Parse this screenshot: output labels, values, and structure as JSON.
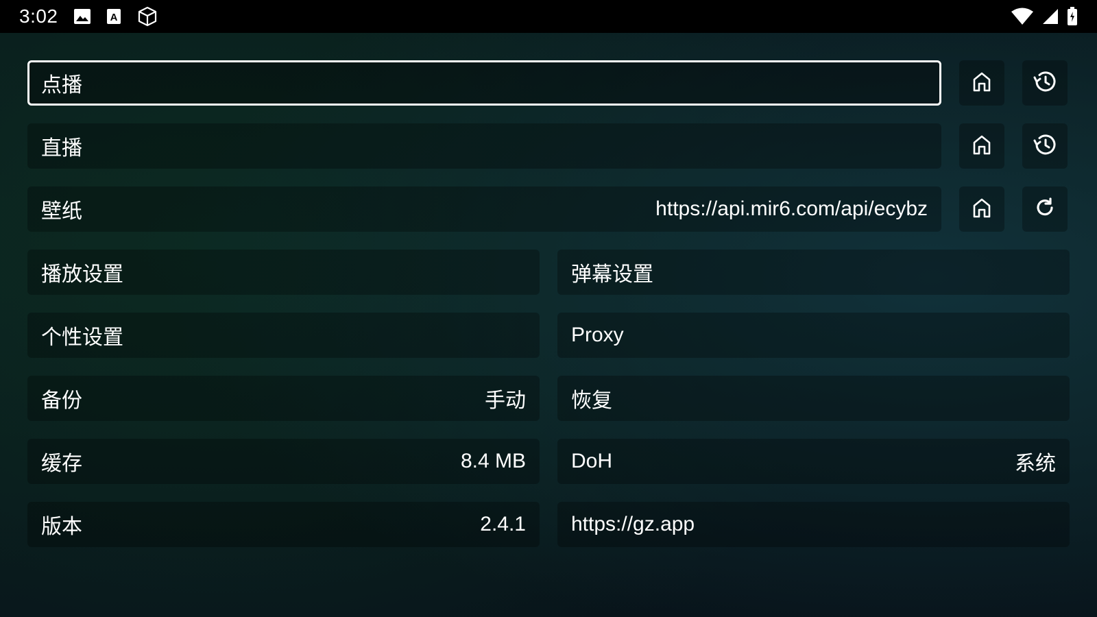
{
  "status_bar": {
    "time": "3:02",
    "left_icons": [
      "image-icon",
      "text-a-icon",
      "cube-icon"
    ],
    "right_icons": [
      "wifi-icon",
      "cell-signal-icon",
      "battery-icon"
    ]
  },
  "rows": {
    "vod": {
      "label": "点播",
      "value": ""
    },
    "live": {
      "label": "直播",
      "value": ""
    },
    "wallpaper": {
      "label": "壁纸",
      "value": "https://api.mir6.com/api/ecybz"
    },
    "player_settings": {
      "label": "播放设置"
    },
    "danmaku_settings": {
      "label": "弹幕设置"
    },
    "personal_settings": {
      "label": "个性设置"
    },
    "proxy": {
      "label": "Proxy"
    },
    "backup": {
      "label": "备份",
      "value": "手动"
    },
    "restore": {
      "label": "恢复"
    },
    "cache": {
      "label": "缓存",
      "value": "8.4 MB"
    },
    "doh": {
      "label": "DoH",
      "value": "系统"
    },
    "version": {
      "label": "版本",
      "value": "2.4.1"
    },
    "website": {
      "label": "https://gz.app"
    }
  },
  "icons": {
    "home": "home-icon",
    "history": "history-icon",
    "refresh": "refresh-icon"
  },
  "colors": {
    "text": "#ffffff",
    "focus_border": "#ffffff",
    "status_bar_bg": "#000000"
  }
}
